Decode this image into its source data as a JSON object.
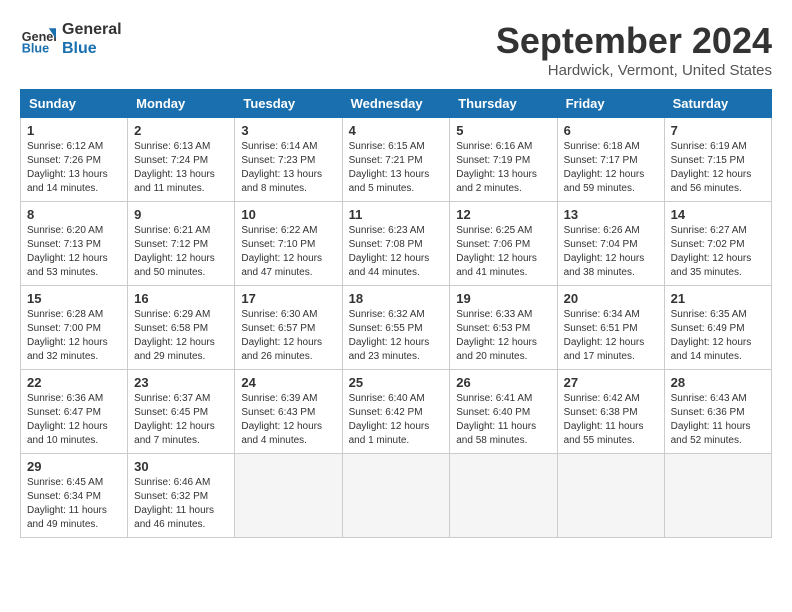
{
  "header": {
    "logo_line1": "General",
    "logo_line2": "Blue",
    "month": "September 2024",
    "location": "Hardwick, Vermont, United States"
  },
  "days_of_week": [
    "Sunday",
    "Monday",
    "Tuesday",
    "Wednesday",
    "Thursday",
    "Friday",
    "Saturday"
  ],
  "weeks": [
    [
      {
        "num": "1",
        "info": "Sunrise: 6:12 AM\nSunset: 7:26 PM\nDaylight: 13 hours\nand 14 minutes."
      },
      {
        "num": "2",
        "info": "Sunrise: 6:13 AM\nSunset: 7:24 PM\nDaylight: 13 hours\nand 11 minutes."
      },
      {
        "num": "3",
        "info": "Sunrise: 6:14 AM\nSunset: 7:23 PM\nDaylight: 13 hours\nand 8 minutes."
      },
      {
        "num": "4",
        "info": "Sunrise: 6:15 AM\nSunset: 7:21 PM\nDaylight: 13 hours\nand 5 minutes."
      },
      {
        "num": "5",
        "info": "Sunrise: 6:16 AM\nSunset: 7:19 PM\nDaylight: 13 hours\nand 2 minutes."
      },
      {
        "num": "6",
        "info": "Sunrise: 6:18 AM\nSunset: 7:17 PM\nDaylight: 12 hours\nand 59 minutes."
      },
      {
        "num": "7",
        "info": "Sunrise: 6:19 AM\nSunset: 7:15 PM\nDaylight: 12 hours\nand 56 minutes."
      }
    ],
    [
      {
        "num": "8",
        "info": "Sunrise: 6:20 AM\nSunset: 7:13 PM\nDaylight: 12 hours\nand 53 minutes."
      },
      {
        "num": "9",
        "info": "Sunrise: 6:21 AM\nSunset: 7:12 PM\nDaylight: 12 hours\nand 50 minutes."
      },
      {
        "num": "10",
        "info": "Sunrise: 6:22 AM\nSunset: 7:10 PM\nDaylight: 12 hours\nand 47 minutes."
      },
      {
        "num": "11",
        "info": "Sunrise: 6:23 AM\nSunset: 7:08 PM\nDaylight: 12 hours\nand 44 minutes."
      },
      {
        "num": "12",
        "info": "Sunrise: 6:25 AM\nSunset: 7:06 PM\nDaylight: 12 hours\nand 41 minutes."
      },
      {
        "num": "13",
        "info": "Sunrise: 6:26 AM\nSunset: 7:04 PM\nDaylight: 12 hours\nand 38 minutes."
      },
      {
        "num": "14",
        "info": "Sunrise: 6:27 AM\nSunset: 7:02 PM\nDaylight: 12 hours\nand 35 minutes."
      }
    ],
    [
      {
        "num": "15",
        "info": "Sunrise: 6:28 AM\nSunset: 7:00 PM\nDaylight: 12 hours\nand 32 minutes."
      },
      {
        "num": "16",
        "info": "Sunrise: 6:29 AM\nSunset: 6:58 PM\nDaylight: 12 hours\nand 29 minutes."
      },
      {
        "num": "17",
        "info": "Sunrise: 6:30 AM\nSunset: 6:57 PM\nDaylight: 12 hours\nand 26 minutes."
      },
      {
        "num": "18",
        "info": "Sunrise: 6:32 AM\nSunset: 6:55 PM\nDaylight: 12 hours\nand 23 minutes."
      },
      {
        "num": "19",
        "info": "Sunrise: 6:33 AM\nSunset: 6:53 PM\nDaylight: 12 hours\nand 20 minutes."
      },
      {
        "num": "20",
        "info": "Sunrise: 6:34 AM\nSunset: 6:51 PM\nDaylight: 12 hours\nand 17 minutes."
      },
      {
        "num": "21",
        "info": "Sunrise: 6:35 AM\nSunset: 6:49 PM\nDaylight: 12 hours\nand 14 minutes."
      }
    ],
    [
      {
        "num": "22",
        "info": "Sunrise: 6:36 AM\nSunset: 6:47 PM\nDaylight: 12 hours\nand 10 minutes."
      },
      {
        "num": "23",
        "info": "Sunrise: 6:37 AM\nSunset: 6:45 PM\nDaylight: 12 hours\nand 7 minutes."
      },
      {
        "num": "24",
        "info": "Sunrise: 6:39 AM\nSunset: 6:43 PM\nDaylight: 12 hours\nand 4 minutes."
      },
      {
        "num": "25",
        "info": "Sunrise: 6:40 AM\nSunset: 6:42 PM\nDaylight: 12 hours\nand 1 minute."
      },
      {
        "num": "26",
        "info": "Sunrise: 6:41 AM\nSunset: 6:40 PM\nDaylight: 11 hours\nand 58 minutes."
      },
      {
        "num": "27",
        "info": "Sunrise: 6:42 AM\nSunset: 6:38 PM\nDaylight: 11 hours\nand 55 minutes."
      },
      {
        "num": "28",
        "info": "Sunrise: 6:43 AM\nSunset: 6:36 PM\nDaylight: 11 hours\nand 52 minutes."
      }
    ],
    [
      {
        "num": "29",
        "info": "Sunrise: 6:45 AM\nSunset: 6:34 PM\nDaylight: 11 hours\nand 49 minutes."
      },
      {
        "num": "30",
        "info": "Sunrise: 6:46 AM\nSunset: 6:32 PM\nDaylight: 11 hours\nand 46 minutes."
      },
      null,
      null,
      null,
      null,
      null
    ]
  ]
}
